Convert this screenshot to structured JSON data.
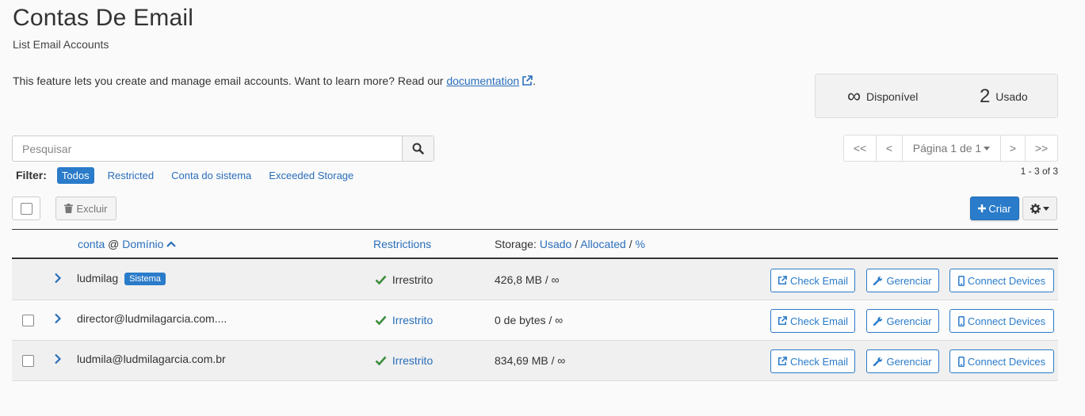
{
  "page": {
    "title": "Contas De Email",
    "subtitle": "List Email Accounts",
    "description": "This feature lets you create and manage email accounts. Want to learn more? Read our ",
    "doc_link": "documentation",
    "description_end": "."
  },
  "stats": {
    "available_value": "∞",
    "available_label": "Disponível",
    "used_value": "2",
    "used_label": "Usado"
  },
  "search": {
    "placeholder": "Pesquisar"
  },
  "filter": {
    "label": "Filter:",
    "options": [
      "Todos",
      "Restricted",
      "Conta do sistema",
      "Exceeded Storage"
    ],
    "active": "Todos"
  },
  "pagination": {
    "first": "<<",
    "prev": "<",
    "page": "Página 1 de 1",
    "next": ">",
    "last": ">>",
    "count": "1 - 3 of 3"
  },
  "toolbar": {
    "delete_label": "Excluir",
    "create_label": "Criar"
  },
  "table": {
    "headers": {
      "account": "conta",
      "at": "@",
      "domain": "Domínio",
      "restrictions": "Restrictions",
      "storage_label": "Storage:",
      "storage_used": "Usado",
      "sep1": "/",
      "storage_allocated": "Allocated",
      "sep2": "/",
      "storage_percent": "%"
    },
    "rows": [
      {
        "account": "ludmilag",
        "badge": "Sistema",
        "restriction": "Irrestrito",
        "storage": "426,8 MB / ∞"
      },
      {
        "account": "director@ludmilagarcia.com....",
        "badge": "",
        "restriction": "Irrestrito",
        "storage": "0 de bytes / ∞"
      },
      {
        "account": "ludmila@ludmilagarcia.com.br",
        "badge": "",
        "restriction": "Irrestrito",
        "storage": "834,69 MB / ∞"
      }
    ],
    "actions": {
      "check_email": "Check Email",
      "manage": "Gerenciar",
      "connect": "Connect Devices"
    }
  },
  "colors": {
    "primary": "#2a7bc9",
    "link": "#2a6ebb",
    "success": "#3c8d3c",
    "background": "#fafafa"
  },
  "icons": {
    "external_link": "external-link-icon",
    "search": "search-icon",
    "trash": "trash-icon",
    "plus": "plus-icon",
    "gear": "gear-icon",
    "caret": "caret-down-icon",
    "chevron_right": "chevron-right-icon",
    "check": "check-icon",
    "wrench": "wrench-icon",
    "mobile": "mobile-icon",
    "sort_up": "sort-up-icon"
  }
}
